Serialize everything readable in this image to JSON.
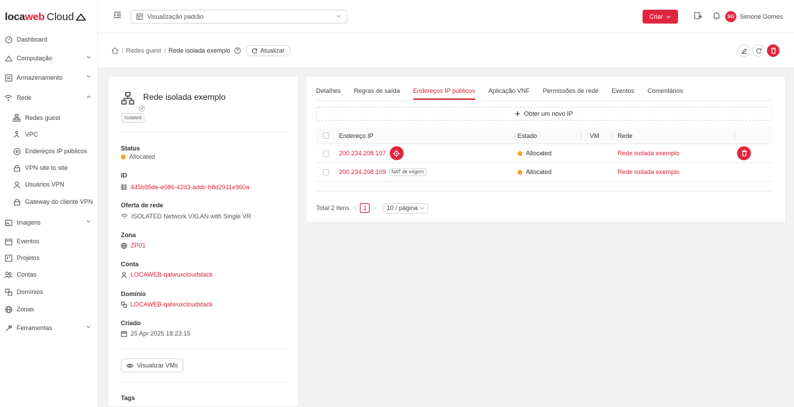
{
  "brand": {
    "part1": "loca",
    "part2": "web",
    "part3": "Cloud"
  },
  "sidebar": {
    "items": [
      {
        "label": "Dashboard"
      },
      {
        "label": "Computação"
      },
      {
        "label": "Armazenamento"
      },
      {
        "label": "Rede"
      },
      {
        "label": "Redes guest"
      },
      {
        "label": "VPC"
      },
      {
        "label": "Endereços IP públicos"
      },
      {
        "label": "VPN site to site"
      },
      {
        "label": "Usuários VPN"
      },
      {
        "label": "Gateway do cliente VPN"
      },
      {
        "label": "Imagens"
      },
      {
        "label": "Eventos"
      },
      {
        "label": "Projetos"
      },
      {
        "label": "Contas"
      },
      {
        "label": "Domínios"
      },
      {
        "label": "Zonas"
      },
      {
        "label": "Ferramentas"
      }
    ]
  },
  "header": {
    "view_select": "Visualização padrão",
    "create_label": "Criar",
    "user_initials": "SG",
    "user_name": "Simone Gomes"
  },
  "breadcrumb": {
    "parent": "Redes guest",
    "current": "Rede isolada exemplo",
    "refresh_label": "Atualizar"
  },
  "details": {
    "title": "Rede isolada exemplo",
    "tag": "Isolated",
    "status_label": "Status",
    "status_value": "Allocated",
    "id_label": "ID",
    "id_value": "445b95de-e086-42d3-addc-b8d2911e960a",
    "offering_label": "Oferta de rede",
    "offering_value": "ISOLATED Network VXLAN with Single VR",
    "zone_label": "Zona",
    "zone_value": "ZP01",
    "account_label": "Conta",
    "account_value": "LOCAWEB-qalwuxcloudstack",
    "domain_label": "Domínio",
    "domain_value": "LOCAWEB-qalwuxcloudstack",
    "created_label": "Criado",
    "created_value": "25 Apr 2025 18:23:15",
    "view_vms_label": "Visualizar VMs",
    "tags_label": "Tags"
  },
  "tabs": [
    {
      "label": "Detalhes"
    },
    {
      "label": "Regras de saída"
    },
    {
      "label": "Endereços IP públicos"
    },
    {
      "label": "Aplicação VNF"
    },
    {
      "label": "Permissões de rede"
    },
    {
      "label": "Eventos"
    },
    {
      "label": "Comentários"
    }
  ],
  "ip_table": {
    "obtain_label": "Obter um novo IP",
    "columns": {
      "ip": "Endereço IP",
      "state": "Estado",
      "vm": "VM",
      "network": "Rede"
    },
    "rows": [
      {
        "ip": "200.234.208.107",
        "tag": "",
        "state": "Allocated",
        "vm": "",
        "network": "Rede isolada exemplo"
      },
      {
        "ip": "200.234.208.109",
        "tag": "NAT de origem",
        "state": "Allocated",
        "vm": "",
        "network": "Rede isolada exemplo"
      }
    ]
  },
  "pagination": {
    "total": "Total 2 itens",
    "page": "1",
    "page_size": "10 / página"
  },
  "colors": {
    "accent": "#e0253e",
    "allocated": "#f5a623"
  }
}
